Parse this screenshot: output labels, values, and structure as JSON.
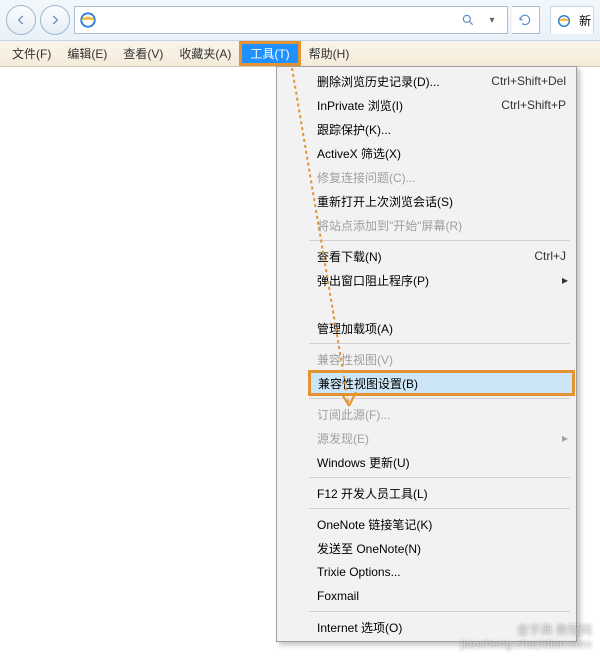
{
  "nav": {
    "addr_placeholder": ""
  },
  "tab": {
    "label": "新"
  },
  "menubar": {
    "items": [
      {
        "label": "文件(F)"
      },
      {
        "label": "编辑(E)"
      },
      {
        "label": "查看(V)"
      },
      {
        "label": "收藏夹(A)"
      },
      {
        "label": "工具(T)"
      },
      {
        "label": "帮助(H)"
      }
    ]
  },
  "dropdown": {
    "groups": [
      [
        {
          "label": "删除浏览历史记录(D)...",
          "shortcut": "Ctrl+Shift+Del"
        },
        {
          "label": "InPrivate 浏览(I)",
          "shortcut": "Ctrl+Shift+P"
        },
        {
          "label": "跟踪保护(K)..."
        },
        {
          "label": "ActiveX 筛选(X)"
        },
        {
          "label": "修复连接问题(C)...",
          "disabled": true
        },
        {
          "label": "重新打开上次浏览会话(S)"
        },
        {
          "label": "将站点添加到\"开始\"屏幕(R)",
          "disabled": true
        }
      ],
      [
        {
          "label": "查看下载(N)",
          "shortcut": "Ctrl+J"
        },
        {
          "label": "弹出窗口阻止程序(P)",
          "submenu": true
        },
        {
          "label": "",
          "disabled": true,
          "blurred": true
        },
        {
          "label": "管理加载项(A)"
        }
      ],
      [
        {
          "label": "兼容性视图(V)",
          "disabled": true
        },
        {
          "label": "兼容性视图设置(B)",
          "highlighted": true
        }
      ],
      [
        {
          "label": "订阅此源(F)...",
          "disabled": true
        },
        {
          "label": "源发现(E)",
          "disabled": true,
          "submenu": true
        },
        {
          "label": "Windows 更新(U)"
        }
      ],
      [
        {
          "label": "F12 开发人员工具(L)"
        }
      ],
      [
        {
          "label": "OneNote 链接笔记(K)"
        },
        {
          "label": "发送至 OneNote(N)"
        },
        {
          "label": "Trixie Options..."
        },
        {
          "label": "Foxmail"
        }
      ],
      [
        {
          "label": "Internet 选项(O)"
        }
      ]
    ]
  },
  "watermark": {
    "line1": "查字典 教程网",
    "line2": "jiaocheng.chazidian.com"
  }
}
